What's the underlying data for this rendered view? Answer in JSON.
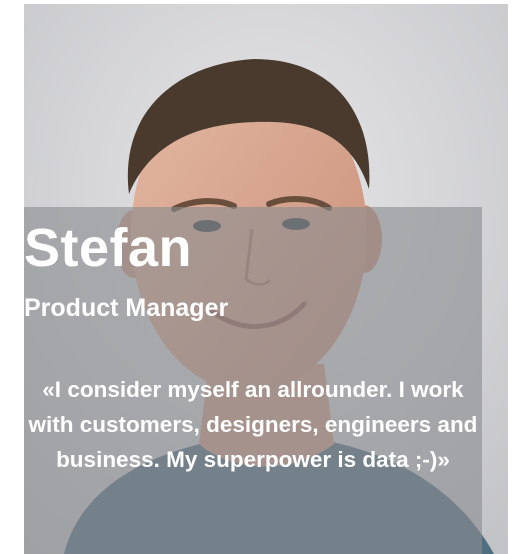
{
  "profile": {
    "name": "Stefan",
    "role": "Product Manager",
    "quote": "«I consider myself an allrounder. I work with customers, designers, engineers and business. My superpower is data ;-)»"
  },
  "colors": {
    "overlay": "#8a8c90",
    "text": "#ffffff",
    "shirt": "#4f6f80"
  }
}
